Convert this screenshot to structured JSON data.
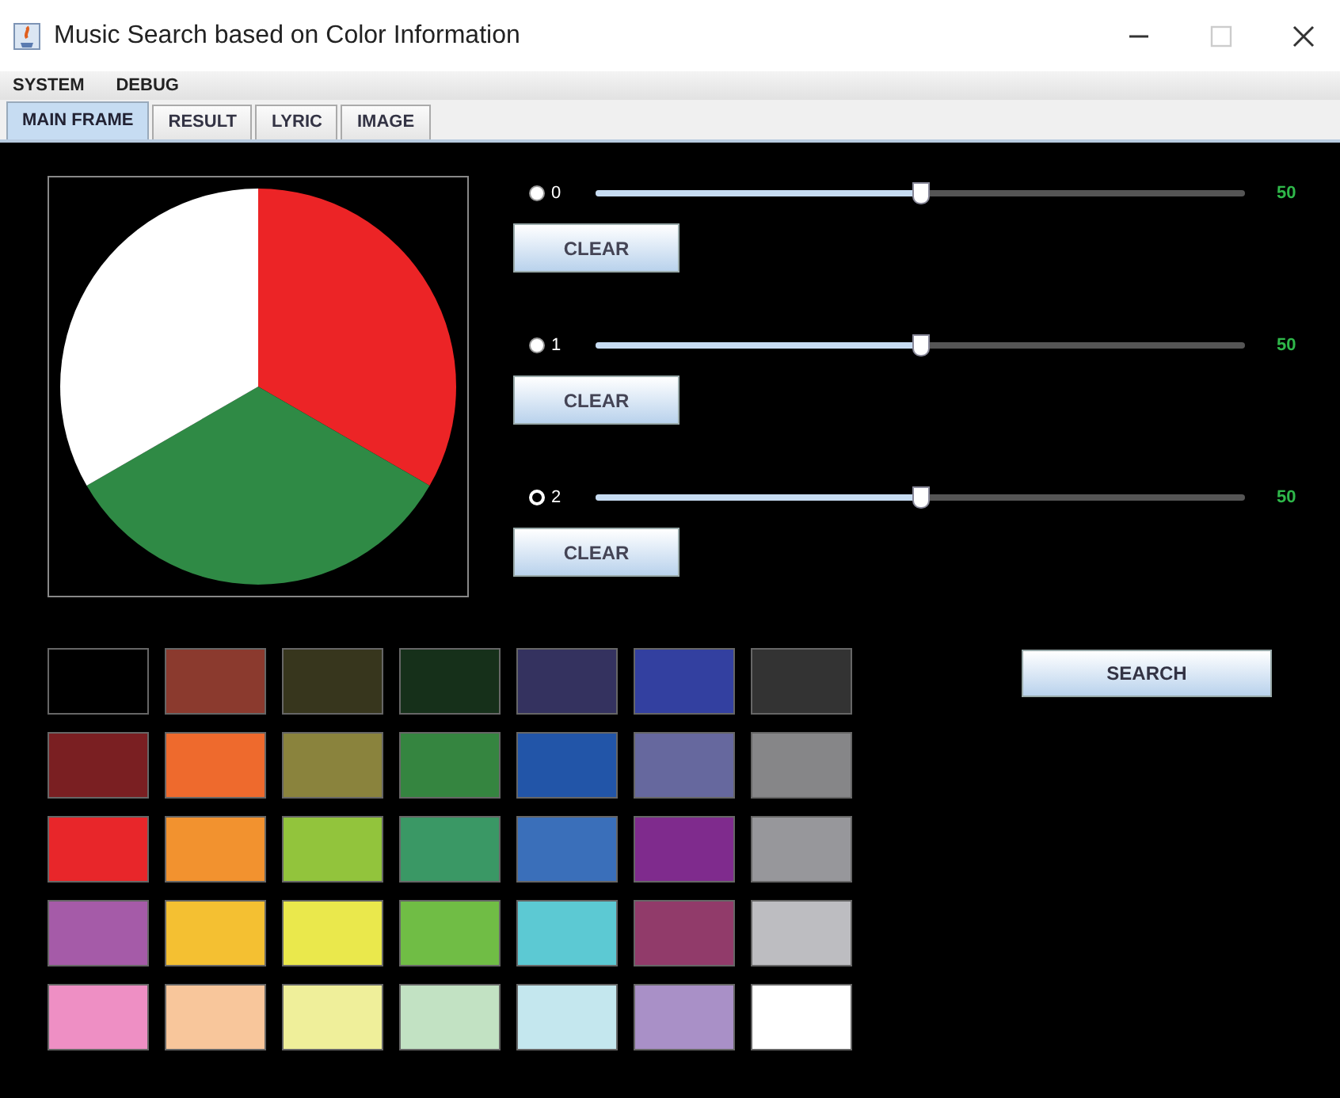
{
  "window": {
    "title": "Music Search based on Color Information"
  },
  "menu": [
    "SYSTEM",
    "DEBUG"
  ],
  "tabs": [
    {
      "label": "MAIN FRAME",
      "selected": true
    },
    {
      "label": "RESULT",
      "selected": false
    },
    {
      "label": "LYRIC",
      "selected": false
    },
    {
      "label": "IMAGE",
      "selected": false
    }
  ],
  "pie": {
    "slices": [
      {
        "color": "#ec2426"
      },
      {
        "color": "#2f8a45"
      },
      {
        "color": "#ffffff"
      }
    ]
  },
  "channels": [
    {
      "label": "0",
      "selected": false,
      "level": 0.5,
      "reading": "50",
      "button": "CLEAR"
    },
    {
      "label": "1",
      "selected": false,
      "level": 0.5,
      "reading": "50",
      "button": "CLEAR"
    },
    {
      "label": "2",
      "selected": true,
      "level": 0.5,
      "reading": "50",
      "button": "CLEAR"
    }
  ],
  "palette": [
    [
      {
        "color": "#000000"
      },
      {
        "color": "#8b3a2e"
      },
      {
        "color": "#37361d"
      },
      {
        "color": "#16301a"
      },
      {
        "color": "#34325f"
      },
      {
        "color": "#3340a0"
      },
      {
        "color": "#333333"
      }
    ],
    [
      {
        "color": "#7a1f22"
      },
      {
        "color": "#ee6a2d"
      },
      {
        "color": "#8a833d"
      },
      {
        "color": "#358540"
      },
      {
        "color": "#2255a8"
      },
      {
        "color": "#66689e"
      },
      {
        "color": "#868688"
      }
    ],
    [
      {
        "color": "#e8262a"
      },
      {
        "color": "#f2922f"
      },
      {
        "color": "#92c43c"
      },
      {
        "color": "#3a9865"
      },
      {
        "color": "#3a6fba"
      },
      {
        "color": "#7f2b8d"
      },
      {
        "color": "#97979b"
      }
    ],
    [
      {
        "color": "#a55ba8"
      },
      {
        "color": "#f4c032"
      },
      {
        "color": "#eae84c"
      },
      {
        "color": "#70bd45"
      },
      {
        "color": "#5cc9d3"
      },
      {
        "color": "#913b6a"
      },
      {
        "color": "#bdbdc1"
      }
    ],
    [
      {
        "color": "#ee8fc4"
      },
      {
        "color": "#f8c69b"
      },
      {
        "color": "#efef9a"
      },
      {
        "color": "#c2e2c3"
      },
      {
        "color": "#c4e7ee"
      },
      {
        "color": "#a990c7"
      },
      {
        "color": "#ffffff"
      }
    ]
  ],
  "search_button": "SEARCH"
}
